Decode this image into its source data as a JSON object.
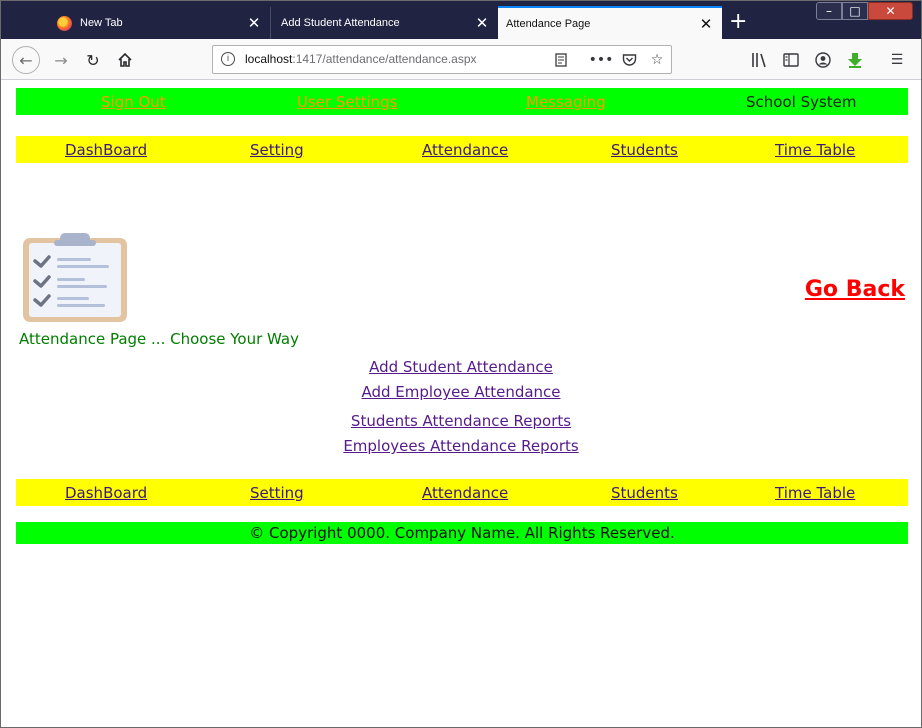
{
  "browser": {
    "tabs": [
      {
        "label": "New Tab"
      },
      {
        "label": "Add Student Attendance"
      },
      {
        "label": "Attendance Page"
      }
    ],
    "url": {
      "host": "localhost",
      "path": ":1417/attendance/attendance.aspx"
    },
    "accent_color": "#0a84ff"
  },
  "header": {
    "links": [
      "Sign Out",
      "User Settings",
      "Messaging"
    ],
    "brand": "School System",
    "bar_color": "#00ff00",
    "link_color": "#ff9900"
  },
  "nav": {
    "items": [
      "DashBoard",
      "Setting",
      "Attendance",
      "Students",
      "Time Table"
    ],
    "bar_color": "#ffff00"
  },
  "main": {
    "image_icon": "attendance-clipboard-icon",
    "caption": "Attendance Page ... Choose Your Way",
    "go_back": "Go Back",
    "links": [
      "Add Student Attendance",
      "Add Employee Attendance",
      "Students Attendance Reports",
      "Employees Attendance Reports"
    ]
  },
  "footer": {
    "text": "© Copyright 0000. Company Name. All Rights Reserved."
  }
}
